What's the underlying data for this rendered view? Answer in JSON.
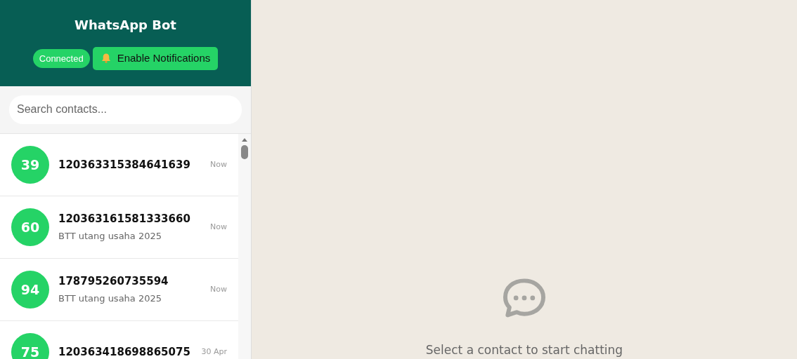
{
  "header": {
    "title": "WhatsApp Bot",
    "status": "Connected",
    "notify_button": "Enable Notifications"
  },
  "search": {
    "placeholder": "Search contacts..."
  },
  "contacts": [
    {
      "avatar": "39",
      "name": "120363315384641639",
      "time": "Now"
    },
    {
      "avatar": "60",
      "name": "120363161581333660",
      "preview": "BTT utang usaha 2025",
      "time": "Now"
    },
    {
      "avatar": "94",
      "name": "178795260735594",
      "preview": "BTT utang usaha 2025",
      "time": "Now"
    },
    {
      "avatar": "75",
      "name": "120363418698865075",
      "time": "30 Apr"
    }
  ],
  "empty_state": {
    "message": "Select a contact to start chatting"
  }
}
